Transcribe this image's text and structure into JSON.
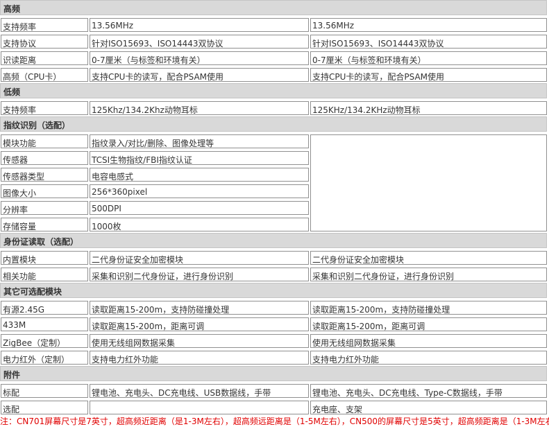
{
  "sections": [
    {
      "title": "高频",
      "rows": [
        [
          "支持频率",
          "13.56MHz",
          "13.56MHz"
        ],
        [
          "支持协议",
          "针对ISO15693、ISO14443双协议",
          "针对ISO15693、ISO14443双协议"
        ],
        [
          "识读距离",
          "0-7厘米（与标签和环境有关）",
          "0-7厘米（与标签和环境有关）"
        ],
        [
          "高频（CPU卡）",
          "支持CPU卡的读写，配合PSAM使用",
          "支持CPU卡的读写，配合PSAM使用"
        ]
      ]
    },
    {
      "title": "低频",
      "rows": [
        [
          "支持频率",
          "125Khz/134.2Khz动物耳标",
          "125KHz/134.2KHz动物耳标"
        ]
      ]
    },
    {
      "title": "指纹识别（选配）",
      "rows": [
        [
          "模块功能",
          "指纹录入/对比/删除、图像处理等"
        ],
        [
          "传感器",
          "TCSI生物指纹/FBI指纹认证"
        ],
        [
          "传感器类型",
          "电容电感式"
        ],
        [
          "图像大小",
          "256*360pixel"
        ],
        [
          "分辨率",
          "500DPI"
        ],
        [
          "存储容量",
          "1000枚"
        ]
      ]
    },
    {
      "title": "身份证读取（选配）",
      "rows": [
        [
          "内置模块",
          "二代身份证安全加密模块",
          "二代身份证安全加密模块"
        ],
        [
          "相关功能",
          "采集和识别二代身份证，进行身份识别",
          "采集和识别二代身份证，进行身份识别"
        ]
      ]
    },
    {
      "title": "其它可选配模块",
      "rows": [
        [
          "有源2.45G",
          "读取距离15-200m，支持防碰撞处理",
          "读取距离15-200m，支持防碰撞处理"
        ],
        [
          "433M",
          "读取距离15-200m，距离可调",
          "读取距离15-200m，距离可调"
        ],
        [
          "ZigBee（定制）",
          "使用无线组网数据采集",
          "使用无线组网数据采集"
        ],
        [
          "电力红外（定制）",
          "支持电力红外功能",
          "支持电力红外功能"
        ]
      ]
    },
    {
      "title": "附件",
      "rows": [
        [
          "标配",
          "锂电池、充电头、DC充电线、USB数据线，手带",
          "锂电池、充电头、DC充电线、Type-C数据线，手带"
        ],
        [
          "选配",
          "",
          "充电座、支架"
        ]
      ]
    }
  ],
  "note": "注：CN701屏幕尺寸是7英寸，超高频近距离（是1-3M左右），超高频远距离是（1-5M左右），CN500的屏幕尺寸是5英寸，超高频距离是（1-3M左右"
}
